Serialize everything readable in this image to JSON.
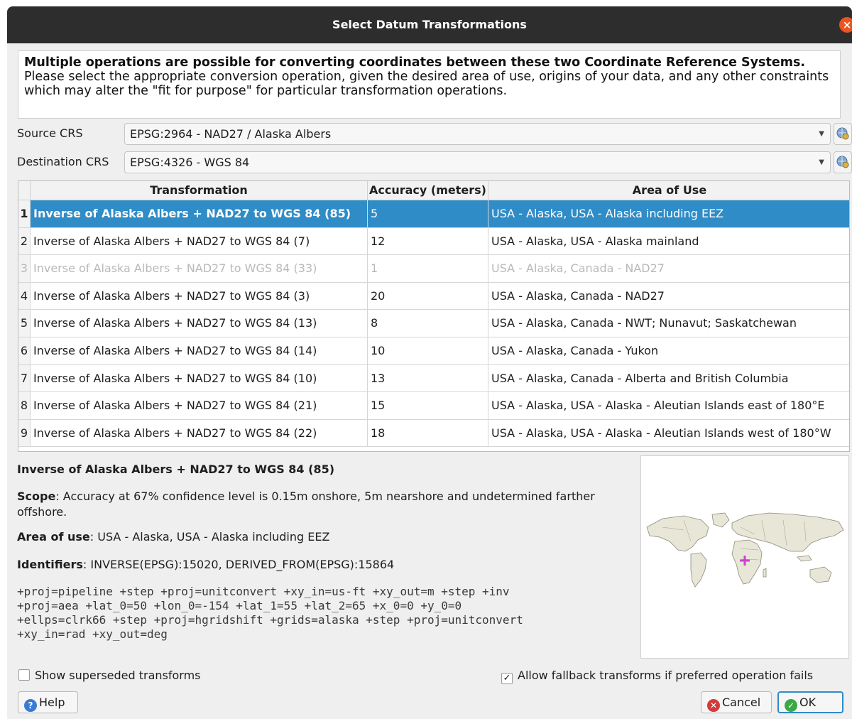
{
  "window": {
    "title": "Select Datum Transformations"
  },
  "message": {
    "bold": "Multiple operations are possible for converting coordinates between these two Coordinate Reference Systems.",
    "rest": " Please select the appropriate conversion operation, given the desired area of use, origins of your data, and any other constraints which may alter the \"fit for purpose\" for particular transformation operations."
  },
  "source_crs": {
    "label": "Source CRS",
    "value": "EPSG:2964 - NAD27 / Alaska Albers"
  },
  "dest_crs": {
    "label": "Destination CRS",
    "value": "EPSG:4326 - WGS 84"
  },
  "table": {
    "headers": [
      "Transformation",
      "Accuracy (meters)",
      "Area of Use"
    ],
    "rows": [
      {
        "num": "1",
        "transformation": "Inverse of Alaska Albers + NAD27 to WGS 84 (85)",
        "accuracy": "5",
        "area": "USA - Alaska, USA - Alaska including EEZ",
        "state": "selected"
      },
      {
        "num": "2",
        "transformation": "Inverse of Alaska Albers + NAD27 to WGS 84 (7)",
        "accuracy": "12",
        "area": "USA - Alaska, USA - Alaska mainland",
        "state": "normal"
      },
      {
        "num": "3",
        "transformation": "Inverse of Alaska Albers + NAD27 to WGS 84 (33)",
        "accuracy": "1",
        "area": "USA - Alaska, Canada - NAD27",
        "state": "disabled"
      },
      {
        "num": "4",
        "transformation": "Inverse of Alaska Albers + NAD27 to WGS 84 (3)",
        "accuracy": "20",
        "area": "USA - Alaska, Canada - NAD27",
        "state": "normal"
      },
      {
        "num": "5",
        "transformation": "Inverse of Alaska Albers + NAD27 to WGS 84 (13)",
        "accuracy": "8",
        "area": "USA - Alaska, Canada - NWT; Nunavut; Saskatchewan",
        "state": "normal"
      },
      {
        "num": "6",
        "transformation": "Inverse of Alaska Albers + NAD27 to WGS 84 (14)",
        "accuracy": "10",
        "area": "USA - Alaska, Canada - Yukon",
        "state": "normal"
      },
      {
        "num": "7",
        "transformation": "Inverse of Alaska Albers + NAD27 to WGS 84 (10)",
        "accuracy": "13",
        "area": "USA - Alaska, Canada - Alberta and British Columbia",
        "state": "normal"
      },
      {
        "num": "8",
        "transformation": "Inverse of Alaska Albers + NAD27 to WGS 84 (21)",
        "accuracy": "15",
        "area": "USA - Alaska, USA - Alaska - Aleutian Islands east of 180°E",
        "state": "normal"
      },
      {
        "num": "9",
        "transformation": "Inverse of Alaska Albers + NAD27 to WGS 84 (22)",
        "accuracy": "18",
        "area": "USA - Alaska, USA - Alaska - Aleutian Islands west of 180°W",
        "state": "normal"
      }
    ]
  },
  "details": {
    "title": "Inverse of Alaska Albers + NAD27 to WGS 84 (85)",
    "scope_label": "Scope",
    "scope_text": ": Accuracy at 67% confidence level is 0.15m onshore, 5m nearshore and undetermined farther offshore.",
    "area_label": "Area of use",
    "area_text": ": USA - Alaska, USA - Alaska including EEZ",
    "ident_label": "Identifiers",
    "ident_text": ": INVERSE(EPSG):15020, DERIVED_FROM(EPSG):15864",
    "proj_string": "+proj=pipeline +step +proj=unitconvert +xy_in=us-ft +xy_out=m +step +inv\n+proj=aea +lat_0=50 +lon_0=-154 +lat_1=55 +lat_2=65 +x_0=0 +y_0=0\n+ellps=clrk66 +step +proj=hgridshift +grids=alaska +step +proj=unitconvert\n+xy_in=rad +xy_out=deg"
  },
  "options": {
    "show_superseded": {
      "label": "Show superseded transforms",
      "checked": false
    },
    "allow_fallback": {
      "label": "Allow fallback transforms if preferred operation fails",
      "checked": true,
      "mark": "✓"
    }
  },
  "buttons": {
    "help": "Help",
    "help_icon": "?",
    "cancel": "Cancel",
    "cancel_icon": "✕",
    "ok": "OK",
    "ok_icon": "✓"
  },
  "icons": {
    "close": "×",
    "dropdown": "▼"
  },
  "colors": {
    "selection": "#308cc6",
    "titlebar": "#2d2d2d",
    "close": "#e95420",
    "map_marker": "#cc44cc"
  }
}
